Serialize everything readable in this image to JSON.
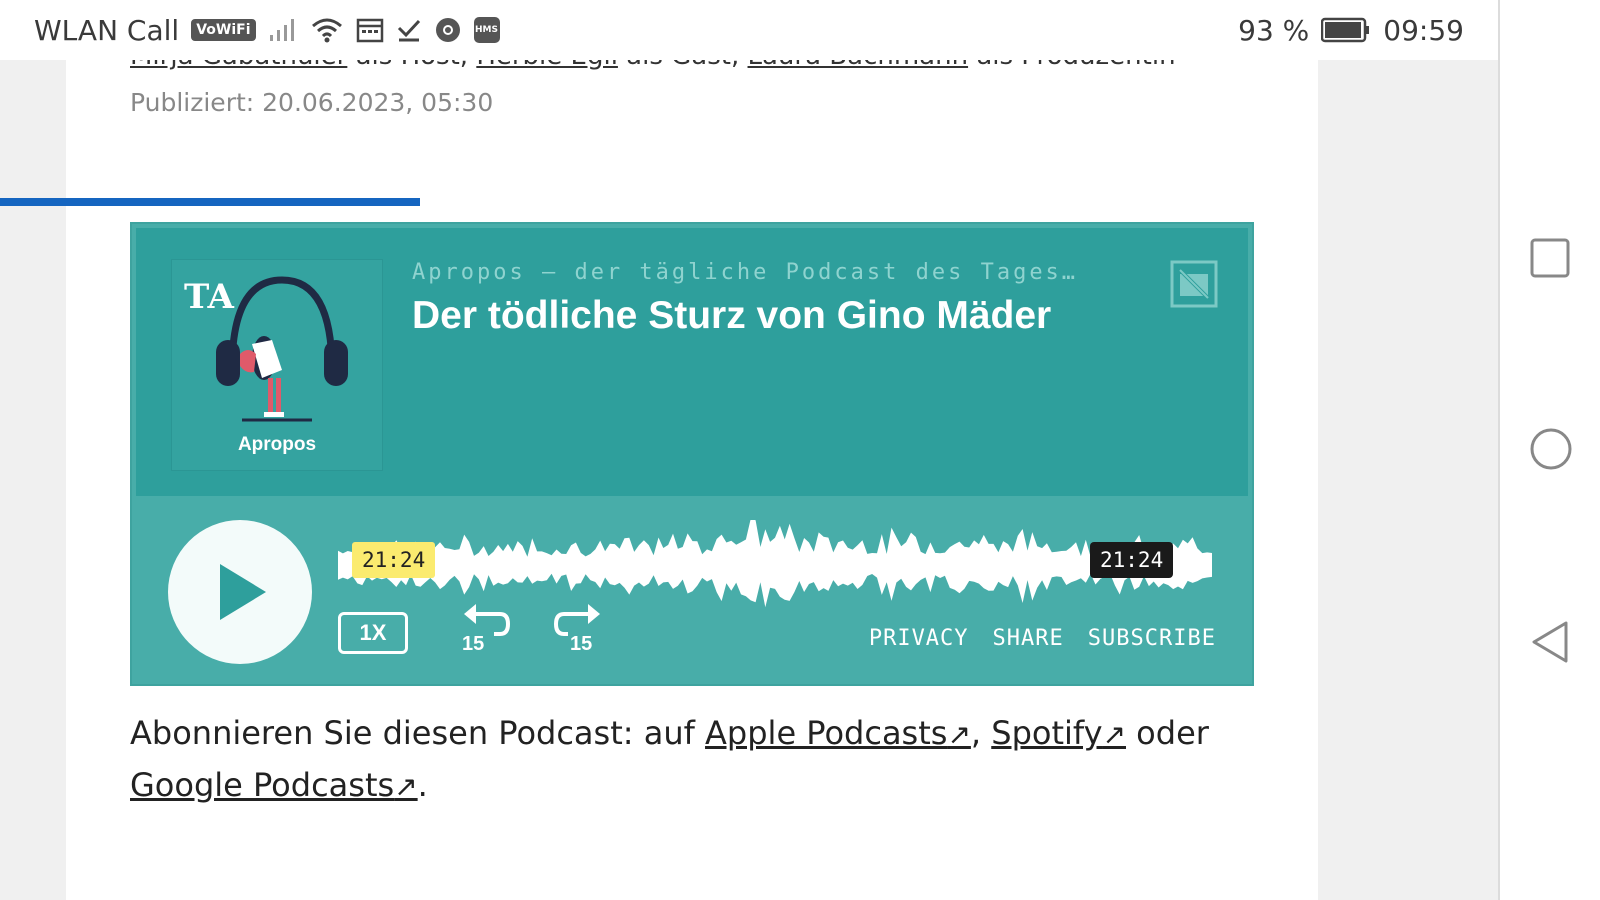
{
  "status_bar": {
    "carrier": "WLAN Call",
    "vowifi_badge": "VoWiFi",
    "hms_badge": "HMS",
    "battery": "93 %",
    "time": "09:59"
  },
  "article": {
    "credits": {
      "host_name": "Mirja Gabathuler",
      "host_role": " als Host, ",
      "guest_name": "Herbie Egli",
      "guest_role": " als Gast, ",
      "producer_name": "Laura Bachmann",
      "producer_role": " als Produzentin"
    },
    "published": "Publiziert: 20.06.2023, 05:30"
  },
  "player": {
    "cover_label": "Apropos",
    "show_name": "Apropos – der tägliche Podcast des Tages…",
    "episode_title": "Der tödliche Sturz von Gino Mäder",
    "current_time": "21:24",
    "total_time": "21:24",
    "speed": "1X",
    "skip_back": "15",
    "skip_forward": "15",
    "links": {
      "privacy": "PRIVACY",
      "share": "SHARE",
      "subscribe": "SUBSCRIBE"
    }
  },
  "subscribe": {
    "intro": "Abonnieren Sie diesen Podcast: auf ",
    "apple": "Apple Podcasts",
    "sep1": ", ",
    "spotify": "Spotify",
    "or": " oder",
    "google": "Google Podcasts",
    "end": ".",
    "arrow": "↗"
  },
  "colors": {
    "player_bg": "#48ada9",
    "player_top": "#2e9f9c",
    "accent_line": "#1565c0",
    "time_highlight": "#fbeb6f"
  }
}
